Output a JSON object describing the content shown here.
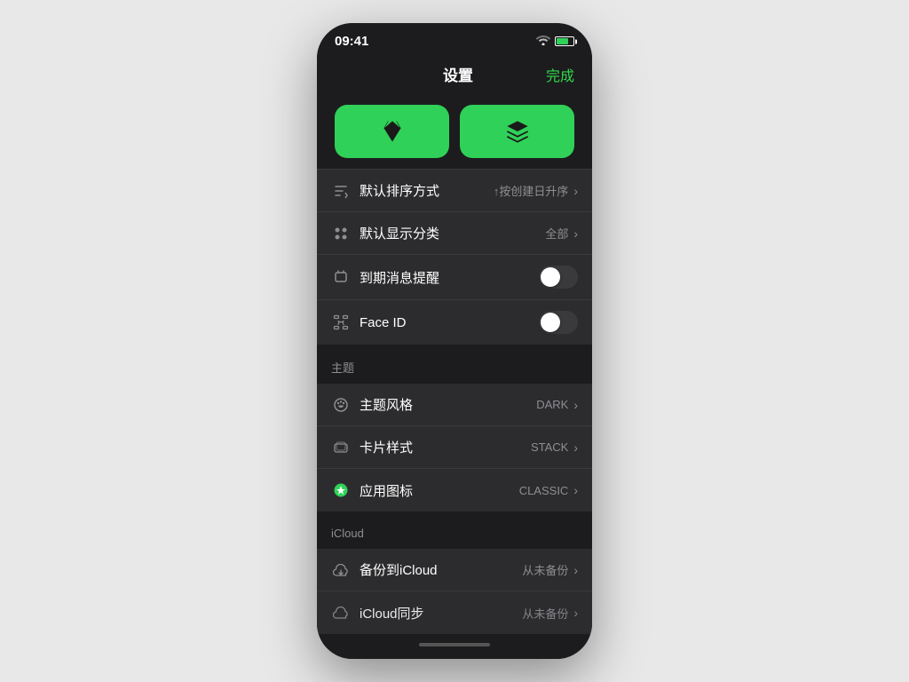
{
  "statusBar": {
    "time": "09:41",
    "timeIcon": "signal-icon"
  },
  "header": {
    "title": "设置",
    "doneLabel": "完成"
  },
  "appIcons": [
    {
      "id": "sketch-icon",
      "type": "diamond"
    },
    {
      "id": "layers-icon",
      "type": "layers"
    }
  ],
  "settingsGeneral": [
    {
      "id": "default-sort",
      "icon": "sort-icon",
      "label": "默认排序方式",
      "value": "↑按创建日升序",
      "type": "chevron"
    },
    {
      "id": "default-category",
      "icon": "category-icon",
      "label": "默认显示分类",
      "value": "全部",
      "type": "chevron"
    },
    {
      "id": "expiry-reminder",
      "icon": "notification-icon",
      "label": "到期消息提醒",
      "value": "",
      "type": "toggle",
      "toggleOn": false
    },
    {
      "id": "face-id",
      "icon": "faceid-icon",
      "label": "Face ID",
      "value": "",
      "type": "toggle",
      "toggleOn": false
    }
  ],
  "themeSection": {
    "header": "主题",
    "items": [
      {
        "id": "theme-style",
        "icon": "palette-icon",
        "label": "主题风格",
        "value": "DARK",
        "type": "chevron"
      },
      {
        "id": "card-style",
        "icon": "card-icon",
        "label": "卡片样式",
        "value": "STACK",
        "type": "chevron"
      },
      {
        "id": "app-icon",
        "icon": "appicon-icon",
        "label": "应用图标",
        "value": "CLASSIC",
        "type": "chevron"
      }
    ]
  },
  "icloudSection": {
    "header": "iCloud",
    "items": [
      {
        "id": "backup-icloud",
        "icon": "cloud-icon",
        "label": "备份到iCloud",
        "value": "从未备份",
        "type": "chevron"
      },
      {
        "id": "icloud-sync",
        "icon": "icloud-icon",
        "label": "iCloud同步",
        "value": "从未备份",
        "type": "chevron",
        "partial": true
      }
    ]
  }
}
